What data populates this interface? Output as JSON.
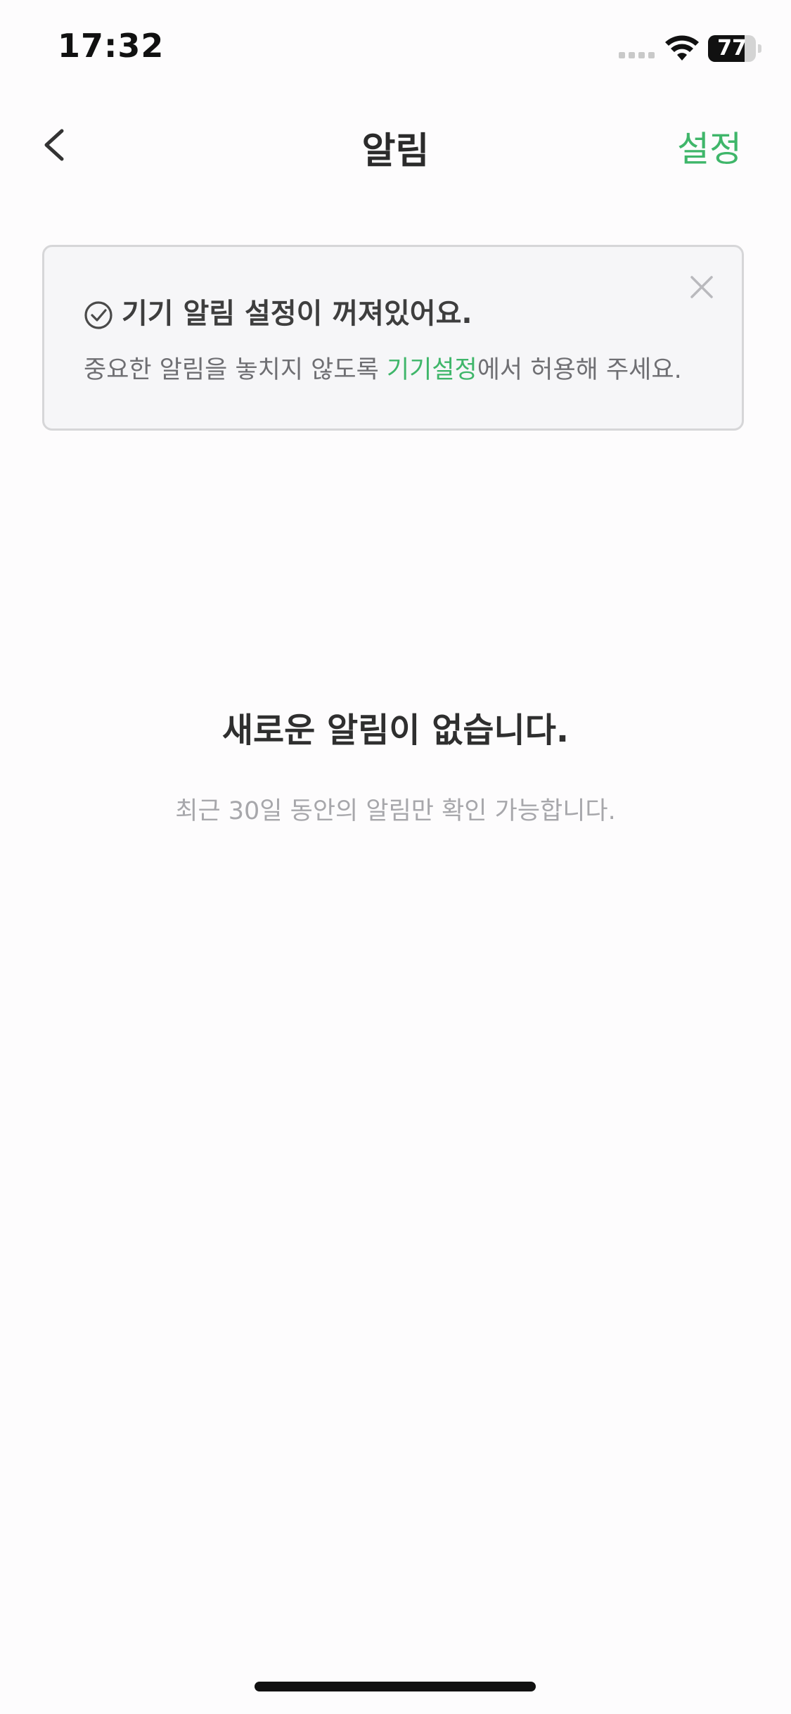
{
  "status_bar": {
    "time": "17:32",
    "battery_level": "77",
    "battery_fraction": 0.77,
    "icons": [
      "cellular-signal-icon",
      "wifi-icon",
      "battery-icon"
    ]
  },
  "header": {
    "title": "알림",
    "settings_label": "설정",
    "back_icon": "chevron-left-icon"
  },
  "notice": {
    "title": "기기 알림 설정이 꺼져있어요.",
    "desc_prefix": "중요한 알림을 놓치지 않도록 ",
    "desc_link": "기기설정",
    "desc_suffix": "에서 허용해 주세요.",
    "icons": [
      "check-circle-icon",
      "close-icon"
    ]
  },
  "empty_state": {
    "title": "새로운 알림이 없습니다.",
    "subtitle": "최근 30일 동안의 알림만 확인 가능합니다."
  },
  "colors": {
    "accent": "#3fb66a",
    "background": "#fdfcfd",
    "card_background": "#f6f6f8",
    "card_border": "#d6d6d8",
    "title_text": "#2b2b2b",
    "muted_text": "#a7a7ab"
  }
}
